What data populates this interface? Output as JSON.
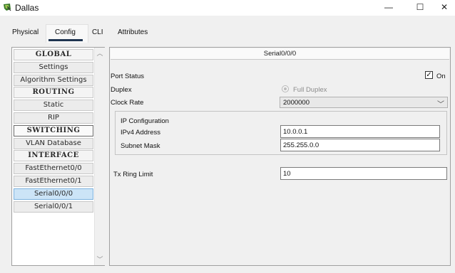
{
  "window": {
    "title": "Dallas",
    "controls": {
      "minimize": "—",
      "maximize": "☐",
      "close": "✕"
    }
  },
  "tabs": [
    {
      "label": "Physical",
      "active": false
    },
    {
      "label": "Config",
      "active": true
    },
    {
      "label": "CLI",
      "active": false
    },
    {
      "label": "Attributes",
      "active": false
    }
  ],
  "sidebar": {
    "items": [
      {
        "label": "GLOBAL",
        "header": true,
        "selected": false
      },
      {
        "label": "Settings",
        "header": false,
        "selected": false
      },
      {
        "label": "Algorithm Settings",
        "header": false,
        "selected": false
      },
      {
        "label": "ROUTING",
        "header": true,
        "selected": false
      },
      {
        "label": "Static",
        "header": false,
        "selected": false
      },
      {
        "label": "RIP",
        "header": false,
        "selected": false
      },
      {
        "label": "SWITCHING",
        "header": true,
        "selected": true
      },
      {
        "label": "VLAN Database",
        "header": false,
        "selected": false
      },
      {
        "label": "INTERFACE",
        "header": true,
        "selected": false
      },
      {
        "label": "FastEthernet0/0",
        "header": false,
        "selected": false
      },
      {
        "label": "FastEthernet0/1",
        "header": false,
        "selected": false
      },
      {
        "label": "Serial0/0/0",
        "header": false,
        "selected": true
      },
      {
        "label": "Serial0/0/1",
        "header": false,
        "selected": false
      }
    ],
    "scroll_up": "︿",
    "scroll_down": "﹀"
  },
  "interface": {
    "title": "Serial0/0/0",
    "port_status_label": "Port Status",
    "port_status_on_label": "On",
    "port_status_checked": true,
    "checkbox_mark": "✓",
    "duplex_label": "Duplex",
    "duplex_value": "Full Duplex",
    "clock_rate_label": "Clock Rate",
    "clock_rate_value": "2000000",
    "dropdown_arrow": "﹀",
    "ip_config": {
      "title": "IP Configuration",
      "ipv4_label": "IPv4 Address",
      "ipv4_value": "10.0.0.1",
      "mask_label": "Subnet Mask",
      "mask_value": "255.255.0.0"
    },
    "tx_ring_label": "Tx Ring Limit",
    "tx_ring_value": "10"
  },
  "colors": {
    "selection_fill": "#cce4f7",
    "selection_border": "#7db2de",
    "tab_underline": "#1f3550",
    "panel_bg": "#f0f0f0"
  }
}
